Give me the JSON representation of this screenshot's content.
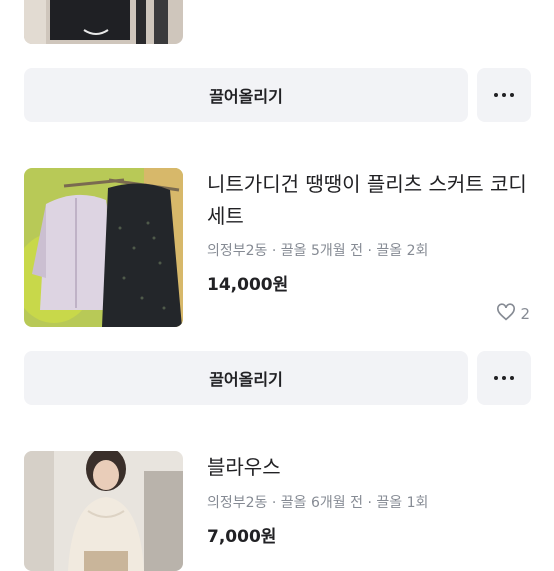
{
  "items": [
    {
      "bump_label": "끌어올리기"
    },
    {
      "title": "니트가디건 땡땡이 플리츠 스커트 코디세트",
      "location": "의정부2동",
      "time": "끌올 5개월 전",
      "bump_count": "끌올 2회",
      "price": "14,000원",
      "likes": "2",
      "bump_label": "끌어올리기"
    },
    {
      "title": "블라우스",
      "location": "의정부2동",
      "time": "끌올 6개월 전",
      "bump_count": "끌올 1회",
      "price": "7,000원"
    }
  ],
  "separator": "·",
  "icons": {
    "more": "more-horizontal-icon",
    "like": "heart-outline-icon"
  }
}
